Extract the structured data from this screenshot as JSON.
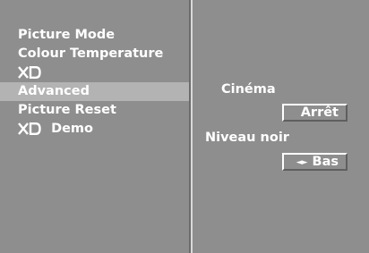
{
  "menu": {
    "items": [
      {
        "label": "Picture Mode"
      },
      {
        "label": "Colour Temperature"
      },
      {
        "label": ""
      },
      {
        "label": "Advanced"
      },
      {
        "label": "Picture Reset"
      },
      {
        "label": "Demo"
      }
    ]
  },
  "advanced": {
    "cinema_label": "Cinéma",
    "cinema_value": "Arrêt",
    "black_level_label": "Niveau noir",
    "black_level_value": "Bas",
    "black_level_arrows": "◄►"
  },
  "colors": {
    "panel_bg": "#8e8e8e",
    "selected_bg": "#b3b3b3",
    "text": "#ffffff"
  }
}
